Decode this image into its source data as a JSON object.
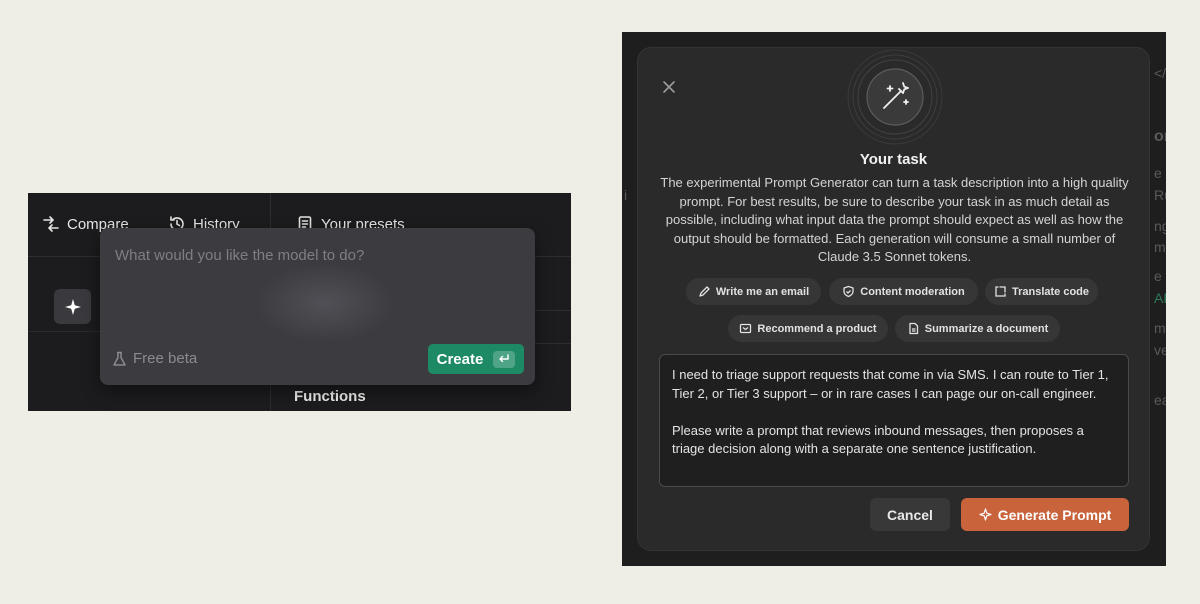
{
  "left": {
    "toolbar": {
      "compare": "Compare",
      "history": "History",
      "presets": "Your presets"
    },
    "popup": {
      "placeholder": "What would you like the model to do?",
      "free_beta": "Free beta",
      "create": "Create"
    },
    "functions": "Functions"
  },
  "right": {
    "background_fragments": [
      "</",
      "or",
      "e",
      "Ru",
      "ng",
      "me",
      "e v",
      "AR",
      "m",
      "ver",
      "ea",
      "i"
    ],
    "modal": {
      "title": "Your task",
      "description": "The experimental Prompt Generator can turn a task description into a high quality prompt. For best results, be sure to describe your task in as much detail as possible, including what input data the prompt should expect as well as how the output should be formatted. Each generation will consume a small number of Claude 3.5 Sonnet tokens.",
      "chips": [
        {
          "label": "Write me an email",
          "icon": "pen-icon"
        },
        {
          "label": "Content moderation",
          "icon": "shield-icon"
        },
        {
          "label": "Translate code",
          "icon": "code-icon"
        },
        {
          "label": "Recommend a product",
          "icon": "tag-icon"
        },
        {
          "label": "Summarize a document",
          "icon": "document-icon"
        }
      ],
      "task_text": "I need to triage support requests that come in via SMS. I can route to Tier 1, Tier 2, or Tier 3 support – or in rare cases I can page our on-call engineer.\n\nPlease write a prompt that reviews inbound messages, then proposes a triage decision along with a separate one sentence justification.",
      "cancel": "Cancel",
      "generate": "Generate Prompt"
    }
  },
  "colors": {
    "page_bg": "#efeee6",
    "create_green": "#1e8a65",
    "generate_orange": "#c8633c"
  }
}
